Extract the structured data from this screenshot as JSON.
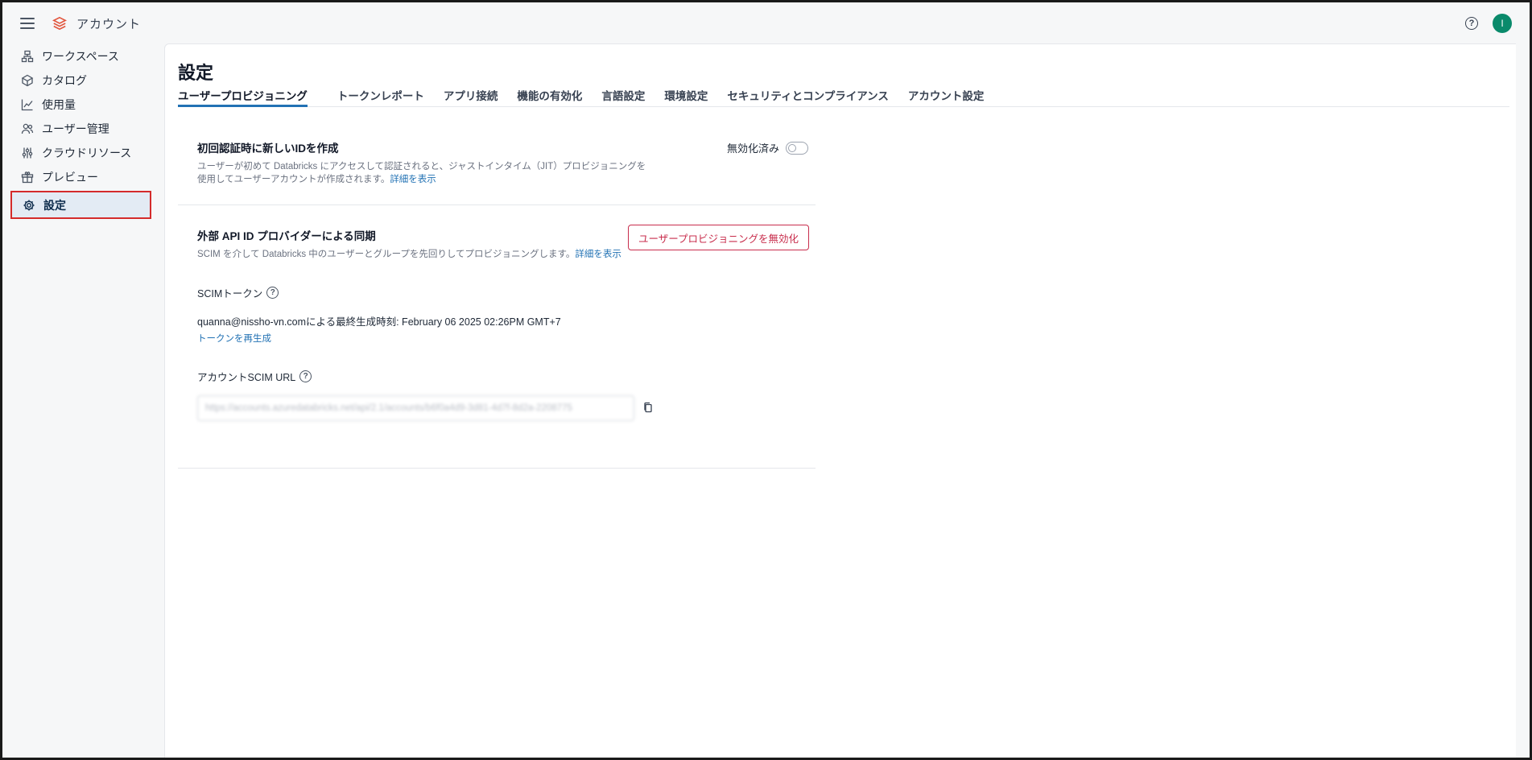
{
  "header": {
    "app_title": "アカウント"
  },
  "sidebar": {
    "items": [
      {
        "label": "ワークスペース",
        "icon": "workspace-icon"
      },
      {
        "label": "カタログ",
        "icon": "catalog-icon"
      },
      {
        "label": "使用量",
        "icon": "usage-chart-icon"
      },
      {
        "label": "ユーザー管理",
        "icon": "users-icon"
      },
      {
        "label": "クラウドリソース",
        "icon": "cloud-resource-icon"
      },
      {
        "label": "プレビュー",
        "icon": "gift-icon"
      },
      {
        "label": "設定",
        "icon": "gear-icon",
        "active": true
      }
    ]
  },
  "main": {
    "title": "設定",
    "tabs": [
      {
        "label": "ユーザープロビジョニング",
        "active": true
      },
      {
        "label": "トークンレポート"
      },
      {
        "label": "アプリ接続"
      },
      {
        "label": "機能の有効化"
      },
      {
        "label": "言語設定"
      },
      {
        "label": "環境設定"
      },
      {
        "label": "セキュリティとコンプライアンス"
      },
      {
        "label": "アカウント設定"
      }
    ],
    "jit": {
      "title": "初回認証時に新しいIDを作成",
      "desc_line1": "ユーザーが初めて Databricks にアクセスして認証されると、ジャストインタイム（JIT）プロビジョニングを",
      "desc_line2": "使用してユーザーアカウントが作成されます。",
      "more_link": "詳細を表示",
      "toggle_label": "無効化済み",
      "toggle_on": false
    },
    "scim": {
      "title": "外部 API ID プロバイダーによる同期",
      "desc": "SCIM を介して Databricks 中のユーザーとグループを先回りしてプロビジョニングします。",
      "more_link": "詳細を表示",
      "disable_button": "ユーザープロビジョニングを無効化",
      "token_label": "SCIMトークン",
      "token_info": "quanna@nissho-vn.comによる最終生成時刻:  February 06 2025 02:26PM GMT+7",
      "regenerate_link": "トークンを再生成",
      "url_label": "アカウントSCIM URL",
      "url_value": "https://accounts.azuredatabricks.net/api/2.1/accounts/b6f0a4d9-3d81-4d7f-8d2a-2208775"
    }
  },
  "colors": {
    "accent": "#2272b4",
    "danger": "#c82d4c",
    "avatar": "#0a8a6b",
    "highlight_border": "#d42b2b"
  }
}
